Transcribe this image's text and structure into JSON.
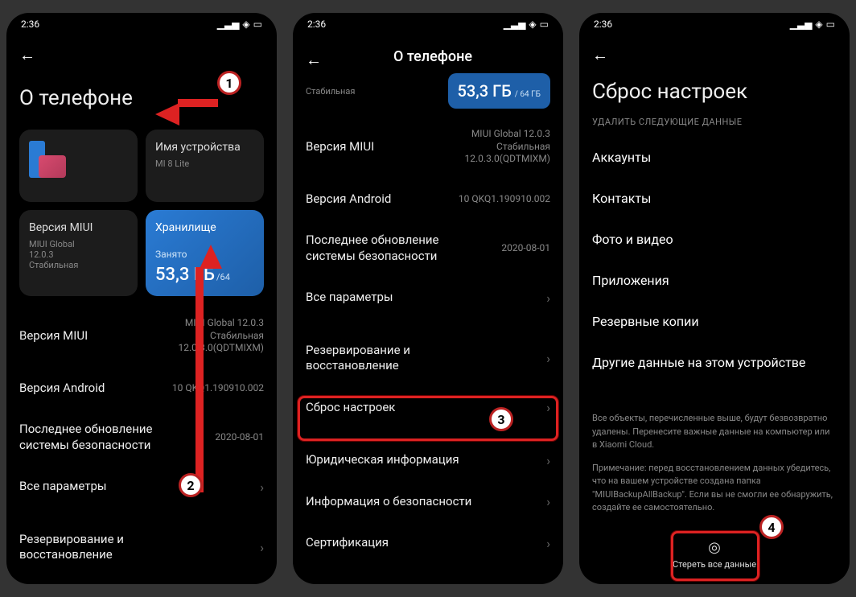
{
  "status": {
    "time": "2:36"
  },
  "screen1": {
    "title": "О телефоне",
    "device_name_label": "Имя устройства",
    "device_name_value": "MI 8 Lite",
    "miui_card_title": "Версия MIUI",
    "miui_card_line1": "MIUI Global",
    "miui_card_line2": "12.0.3",
    "miui_card_line3": "Стабильная",
    "storage_label": "Хранилище",
    "storage_used_label": "Занято",
    "storage_used_value": "53,3 ГБ",
    "storage_total": "/64",
    "items": {
      "miui": {
        "label": "Версия MIUI",
        "value": "MIUI Global 12.0.3\nСтабильная\n12.0.3.0(QDTMIXM)"
      },
      "android": {
        "label": "Версия Android",
        "value": "10 QKQ1.190910.002"
      },
      "security": {
        "label": "Последнее обновление системы безопасности",
        "value": "2020-08-01"
      },
      "allspecs": {
        "label": "Все параметры"
      },
      "backup": {
        "label": "Резервирование и восстановление"
      }
    }
  },
  "screen2": {
    "title": "О телефоне",
    "stable_hint": "Стабильная",
    "storage_value": "53,3 ГБ",
    "storage_total": "/ 64 ГБ",
    "items": {
      "miui": {
        "label": "Версия MIUI",
        "value": "MIUI Global 12.0.3\nСтабильная\n12.0.3.0(QDTMIXM)"
      },
      "android": {
        "label": "Версия Android",
        "value": "10 QKQ1.190910.002"
      },
      "security": {
        "label": "Последнее обновление системы безопасности",
        "value": "2020-08-01"
      },
      "allspecs": {
        "label": "Все параметры"
      },
      "backup": {
        "label": "Резервирование и восстановление"
      },
      "reset": {
        "label": "Сброс настроек"
      },
      "legal": {
        "label": "Юридическая информация"
      },
      "safety": {
        "label": "Информация о безопасности"
      },
      "cert": {
        "label": "Сертификация"
      }
    }
  },
  "screen3": {
    "title": "Сброс настроек",
    "subtitle": "УДАЛИТЬ СЛЕДУЮЩИЕ ДАННЫЕ",
    "items": {
      "accounts": "Аккаунты",
      "contacts": "Контакты",
      "media": "Фото и видео",
      "apps": "Приложения",
      "backups": "Резервные копии",
      "other": "Другие данные на этом устройстве"
    },
    "note1": "Все объекты, перечисленные выше, будут безвозвратно удалены. Перенесите важные данные на компьютер или в Xiaomi Cloud.",
    "note2": "Примечание: перед восстановлением данных убедитесь, что на вашем устройстве создана папка \"MIUIBackupAllBackup\". Если вы не смогли ее обнаружить, создайте ее самостоятельно.",
    "action": "Стереть все данные"
  },
  "annotations": {
    "n1": "1",
    "n2": "2",
    "n3": "3",
    "n4": "4"
  }
}
